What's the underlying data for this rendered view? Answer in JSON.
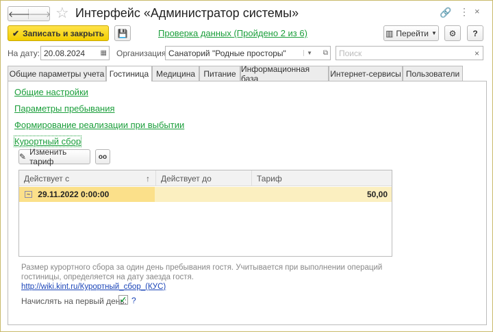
{
  "window": {
    "title": "Интерфейс «Администратор системы»"
  },
  "toolbar": {
    "save_close": "Записать и закрыть",
    "check_link": "Проверка данных (Пройдено 2 из 6)",
    "goto": "Перейти",
    "help": "?"
  },
  "filters": {
    "date_label": "На дату:",
    "date_value": "20.08.2024",
    "org_label": "Организация:",
    "org_value": "Санаторий \"Родные просторы\"",
    "search_placeholder": "Поиск"
  },
  "tabs": [
    "Общие параметры учета",
    "Гостиница",
    "Медицина",
    "Питание",
    "Информационная база",
    "Интернет-сервисы",
    "Пользователи"
  ],
  "links": [
    "Общие настройки",
    "Параметры пребывания",
    "Формирование реализации при выбытии",
    "Курортный сбор"
  ],
  "table": {
    "change_button": "Изменить тариф",
    "columns": [
      "Действует с",
      "Действует до",
      "Тариф"
    ],
    "sort_indicator": "↑",
    "rows": [
      {
        "from": "29.11.2022 0:00:00",
        "to": "",
        "rate": "50,00"
      }
    ]
  },
  "note": {
    "text1": "Размер курортного сбора за один день пребывания гостя. Учитывается при выполнении операций",
    "text2": "гостиницы, определяется на дату заезда гостя.",
    "url": "http://wiki.kint.ru/Курортный_сбор_(КУС)"
  },
  "first_day": {
    "label": "Начислять на первый день:",
    "checked": true,
    "help": "?"
  }
}
